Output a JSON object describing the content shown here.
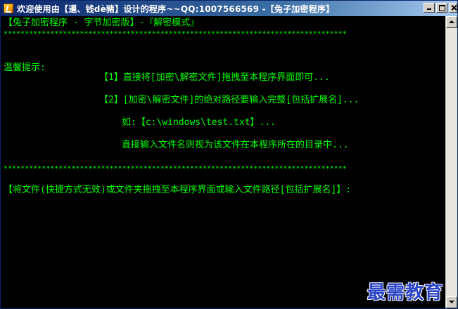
{
  "window": {
    "title": "欢迎使用由【暹、钱dè豬】设计的程序~~QQ:1007566569 -【兔子加密程序】"
  },
  "console": {
    "header": "【兔子加密程序 - 字节加密版】-『解密模式』",
    "stars_top": "*********************************************************************************",
    "tip_label": "温馨提示:",
    "tip1": "【1】直接将[加密\\解密文件]拖拽至本程序界面即可...",
    "tip2": "【2】[加密\\解密文件]的绝对路径要输入完整[包括扩展名]...",
    "tip2_example": "如:【c:\\windows\\test.txt】...",
    "tip2_note": "直接输入文件名则视为该文件在本程序所在的目录中...",
    "stars_bottom": "*********************************************************************************",
    "prompt": "【将文件(快捷方式无效)或文件夹拖拽至本程序界面或输入文件路径[包括扩展名]】:"
  },
  "watermark": "最需教育",
  "colors": {
    "console_bg": "#000000",
    "console_text": "#00ff00",
    "title_bar": "#0a246a",
    "watermark": "#2c44c8"
  }
}
